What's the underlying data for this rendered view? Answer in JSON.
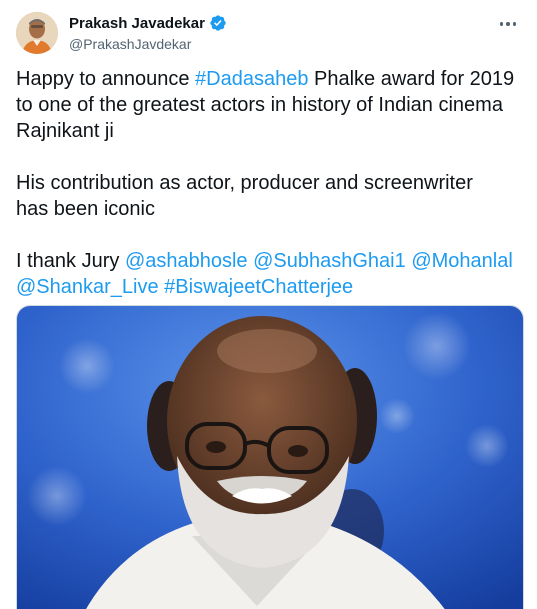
{
  "author": {
    "display_name": "Prakash Javadekar",
    "handle": "@PrakashJavdekar",
    "verified": true
  },
  "tweet": {
    "line1_pre": "Happy to announce ",
    "line1_hashtag": "#Dadasaheb",
    "line1_post": " Phalke award for 2019",
    "line2": "to one of the greatest actors in history of Indian cinema",
    "line3": "Rajnikant ji",
    "line4": "His contribution as actor, producer and screenwriter",
    "line5": "has been iconic",
    "line6_pre": "I thank Jury ",
    "mention1": "@ashabhosle",
    "mention2": "@SubhashGhai1",
    "mention3": "@Mohanlal",
    "mention4": "@Shankar_Live",
    "hashtag2": "#BiswajeetChatterjee"
  },
  "icons": {
    "verified": "verified-badge-icon",
    "more": "more-options-icon"
  },
  "colors": {
    "link": "#1d9bf0",
    "text": "#0f1419",
    "secondary": "#536471",
    "media_bg": "#2d5fc4"
  }
}
